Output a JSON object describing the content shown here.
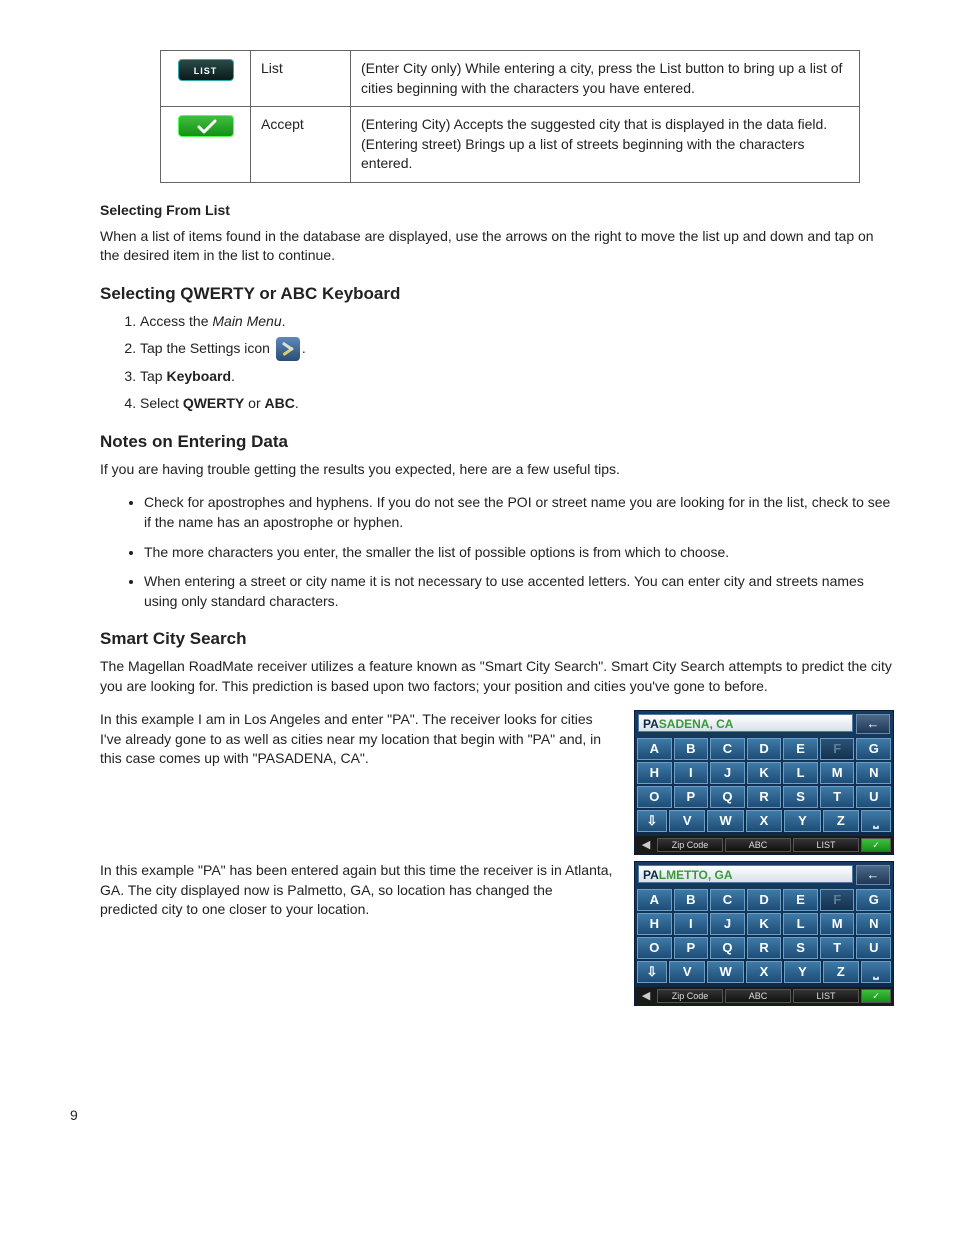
{
  "table": {
    "rows": [
      {
        "icon_label": "LIST",
        "name": "List",
        "desc": "(Enter City only)  While entering a city, press the List button to bring up a list of cities beginning with the characters you have entered."
      },
      {
        "icon_label": "accept",
        "name": "Accept",
        "desc": "(Entering City)  Accepts the suggested city that is displayed in the data field.  (Entering street) Brings up a list of streets beginning with the characters entered."
      }
    ]
  },
  "selecting_from_list": {
    "heading": "Selecting From List",
    "body": "When a list of items found in the database are displayed, use the arrows on the right to move the list up and down and tap on the desired item in the list to continue."
  },
  "keyboard_section": {
    "heading": "Selecting QWERTY or ABC Keyboard",
    "steps": {
      "s1_pre": "Access the ",
      "s1_em": "Main Menu",
      "s1_post": ".",
      "s2_pre": "Tap the Settings icon ",
      "s2_post": ".",
      "s3_pre": "Tap ",
      "s3_bold": "Keyboard",
      "s3_post": ".",
      "s4_pre": "Select ",
      "s4_b1": "QWERTY",
      "s4_mid": " or ",
      "s4_b2": "ABC",
      "s4_post": "."
    }
  },
  "notes": {
    "heading": "Notes on Entering Data",
    "intro": "If you are having trouble getting the results you expected, here are a few useful tips.",
    "bullets": [
      "Check for apostrophes and hyphens. If you do not see the POI or street name you are looking for in the list, check to see if the name has an apostrophe or hyphen.",
      "The more characters you enter, the smaller the list of possible options is from which to choose.",
      "When entering a street or city name it is not necessary to use accented letters. You can enter city and streets names using only standard characters."
    ]
  },
  "smart": {
    "heading": "Smart City Search",
    "intro": "The Magellan RoadMate receiver utilizes a feature known as \"Smart City Search\".  Smart City Search attempts to predict the city you are looking for.  This prediction is based upon two factors; your position and cities you've gone to before.",
    "ex1_text": "In this example I am in Los Angeles and enter \"PA\".  The receiver looks for cities I've already gone to as well as cities near my location that begin with \"PA\" and, in this case comes up with \"PASADENA, CA\".",
    "ex2_text": "In this example \"PA\" has been entered again but this time the receiver is in Atlanta, GA.  The city displayed now is Palmetto, GA, so location has changed the predicted city to one closer to your location."
  },
  "kbd_common": {
    "back_glyph": "←",
    "shift_glyph": "⇩",
    "space_glyph": "⎵",
    "rows": [
      [
        "A",
        "B",
        "C",
        "D",
        "E",
        "F",
        "G"
      ],
      [
        "H",
        "I",
        "J",
        "K",
        "L",
        "M",
        "N"
      ],
      [
        "O",
        "P",
        "Q",
        "R",
        "S",
        "T",
        "U"
      ]
    ],
    "row4": [
      "V",
      "W",
      "X",
      "Y",
      "Z"
    ],
    "bottom": {
      "arrow": "◀",
      "zip": "Zip Code",
      "abc": "ABC",
      "list": "LIST",
      "check": "✓"
    }
  },
  "kbd1": {
    "typed": "PA",
    "suggest": "SADENA, CA",
    "dim_letters": [
      "F"
    ]
  },
  "kbd2": {
    "typed": "PA",
    "suggest": "LMETTO, GA",
    "dim_letters": [
      "F"
    ]
  },
  "page_number": "9"
}
